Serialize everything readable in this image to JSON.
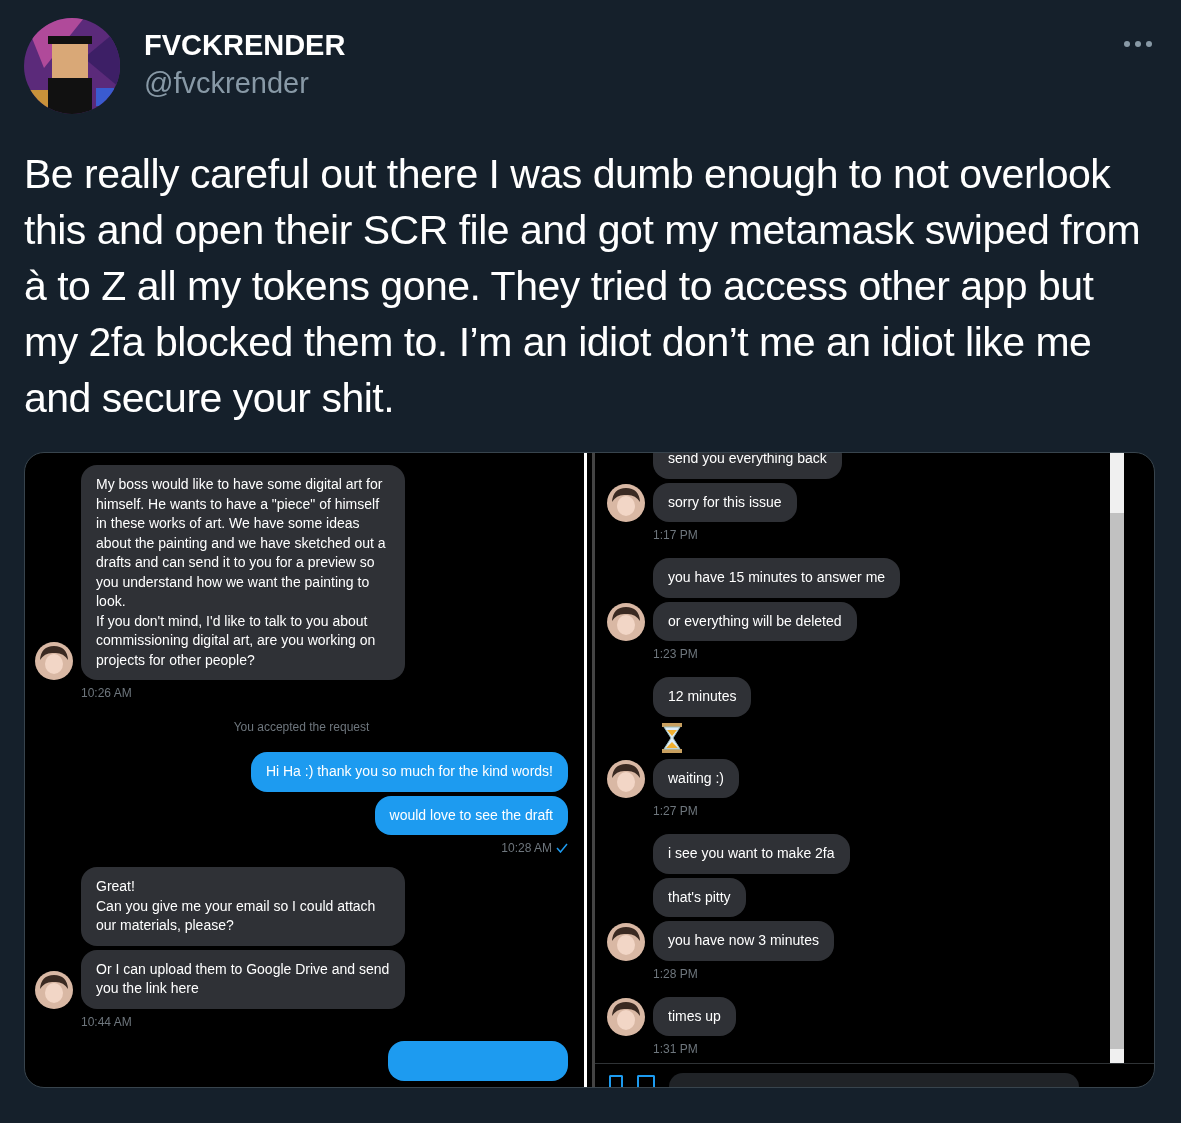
{
  "author": {
    "name": "FVCKRENDER",
    "handle": "@fvckrender"
  },
  "tweet_text": "Be really careful out there I was dumb enough to not overlook this and open their SCR file and got my metamask swiped from à to Z all my tokens gone. They tried to access other app but my 2fa blocked them to. I’m an idiot don’t me an idiot like me and secure your shit.",
  "left_chat": [
    {
      "kind": "incoming",
      "bubbles": [
        {
          "kind": "text",
          "text": "My boss would like to have some digital art for himself. He wants to have a \"piece\" of himself in these works of art. We have some ideas about the painting and we have sketched out a drafts and can send it to you for a preview so you understand how we want the painting to look.\nIf you don't mind, I'd like to talk to you about commissioning digital art, are you working on projects for other people?"
        }
      ],
      "time": "10:26 AM"
    },
    {
      "kind": "notice",
      "text": "You accepted the request"
    },
    {
      "kind": "outgoing",
      "bubbles": [
        {
          "kind": "text",
          "text": "Hi Ha :) thank you so much for the kind words!"
        },
        {
          "kind": "text",
          "text": "would love to see the draft"
        }
      ],
      "time": "10:28 AM",
      "read": true
    },
    {
      "kind": "incoming",
      "bubbles": [
        {
          "kind": "text",
          "text": "Great!\nCan you give me your email so I could attach our materials, please?"
        },
        {
          "kind": "text",
          "text": "Or I can upload them to Google Drive and send you the link here"
        }
      ],
      "time": "10:44 AM"
    },
    {
      "kind": "cut_bubble"
    }
  ],
  "right_chat": [
    {
      "kind": "incoming",
      "bubbles": [
        {
          "kind": "text",
          "text": "send you everything back"
        },
        {
          "kind": "text",
          "text": "sorry for this issue"
        }
      ],
      "time": "1:17 PM"
    },
    {
      "kind": "incoming",
      "bubbles": [
        {
          "kind": "text",
          "text": "you have 15 minutes to answer me"
        },
        {
          "kind": "text",
          "text": "or everything will be deleted"
        }
      ],
      "time": "1:23 PM"
    },
    {
      "kind": "incoming",
      "bubbles": [
        {
          "kind": "text",
          "text": "12 minutes"
        },
        {
          "kind": "hourglass"
        },
        {
          "kind": "text",
          "text": "waiting :)"
        }
      ],
      "time": "1:27 PM"
    },
    {
      "kind": "incoming",
      "bubbles": [
        {
          "kind": "text",
          "text": "i see you want to make 2fa"
        },
        {
          "kind": "text",
          "text": "that's pitty"
        },
        {
          "kind": "text",
          "text": "you have now 3 minutes"
        }
      ],
      "time": "1:28 PM"
    },
    {
      "kind": "incoming",
      "bubbles": [
        {
          "kind": "text",
          "text": "times up"
        }
      ],
      "time": "1:31 PM"
    }
  ]
}
